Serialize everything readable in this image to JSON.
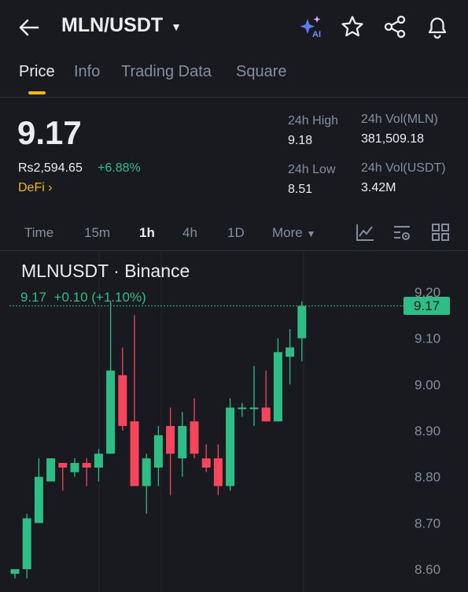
{
  "header": {
    "pair": "MLN/USDT",
    "icons": [
      "back-arrow-icon",
      "ai-sparkle-icon",
      "star-icon",
      "share-icon",
      "bell-icon"
    ]
  },
  "tabs": [
    {
      "label": "Price",
      "active": true
    },
    {
      "label": "Info",
      "active": false
    },
    {
      "label": "Trading Data",
      "active": false
    },
    {
      "label": "Square",
      "active": false
    }
  ],
  "ticker": {
    "price": "9.17",
    "fiat_price": "Rs2,594.65",
    "change_pct": "+6.88%",
    "tag": "DeFi",
    "high_label": "24h High",
    "high_value": "9.18",
    "low_label": "24h Low",
    "low_value": "8.51",
    "vol_base_label": "24h Vol(MLN)",
    "vol_base_value": "381,509.18",
    "vol_quote_label": "24h Vol(USDT)",
    "vol_quote_value": "3.42M"
  },
  "timeframes": {
    "items": [
      "Time",
      "15m",
      "1h",
      "4h",
      "1D"
    ],
    "active": "1h",
    "more_label": "More",
    "tools": [
      "indicator-icon",
      "chart-settings-icon",
      "layout-grid-icon"
    ]
  },
  "chart": {
    "title": "MLNUSDT · Binance",
    "ohlc_summary": "9.17  +0.10 (+1.10%)",
    "last_price_label": "9.17",
    "up_color": "#2ebd85",
    "down_color": "#f6465d"
  },
  "chart_data": {
    "type": "candlestick",
    "title": "MLNUSDT · Binance",
    "y_ticks": [
      "9.20",
      "9.10",
      "9.00",
      "8.90",
      "8.80",
      "8.70",
      "8.60"
    ],
    "ylim": [
      8.55,
      9.25
    ],
    "last_price": 9.17,
    "candles": [
      {
        "o": 8.59,
        "h": 8.6,
        "l": 8.58,
        "c": 8.6
      },
      {
        "o": 8.6,
        "h": 8.72,
        "l": 8.58,
        "c": 8.71
      },
      {
        "o": 8.7,
        "h": 8.84,
        "l": 8.7,
        "c": 8.8
      },
      {
        "o": 8.79,
        "h": 8.84,
        "l": 8.79,
        "c": 8.84
      },
      {
        "o": 8.83,
        "h": 8.83,
        "l": 8.77,
        "c": 8.82
      },
      {
        "o": 8.81,
        "h": 8.84,
        "l": 8.8,
        "c": 8.83
      },
      {
        "o": 8.83,
        "h": 8.84,
        "l": 8.78,
        "c": 8.82
      },
      {
        "o": 8.82,
        "h": 8.86,
        "l": 8.79,
        "c": 8.85
      },
      {
        "o": 8.85,
        "h": 9.18,
        "l": 8.85,
        "c": 9.03
      },
      {
        "o": 9.02,
        "h": 9.08,
        "l": 8.9,
        "c": 8.91
      },
      {
        "o": 8.92,
        "h": 9.15,
        "l": 8.78,
        "c": 8.78
      },
      {
        "o": 8.78,
        "h": 8.85,
        "l": 8.72,
        "c": 8.84
      },
      {
        "o": 8.82,
        "h": 8.91,
        "l": 8.78,
        "c": 8.89
      },
      {
        "o": 8.91,
        "h": 8.95,
        "l": 8.76,
        "c": 8.85
      },
      {
        "o": 8.84,
        "h": 8.94,
        "l": 8.8,
        "c": 8.91
      },
      {
        "o": 8.92,
        "h": 8.97,
        "l": 8.84,
        "c": 8.85
      },
      {
        "o": 8.84,
        "h": 8.87,
        "l": 8.81,
        "c": 8.82
      },
      {
        "o": 8.84,
        "h": 8.87,
        "l": 8.76,
        "c": 8.78
      },
      {
        "o": 8.78,
        "h": 8.97,
        "l": 8.77,
        "c": 8.95
      },
      {
        "o": 8.95,
        "h": 8.96,
        "l": 8.93,
        "c": 8.95
      },
      {
        "o": 8.95,
        "h": 9.04,
        "l": 8.91,
        "c": 8.95
      },
      {
        "o": 8.95,
        "h": 9.03,
        "l": 8.92,
        "c": 8.92
      },
      {
        "o": 8.92,
        "h": 9.1,
        "l": 8.92,
        "c": 9.07
      },
      {
        "o": 9.06,
        "h": 9.12,
        "l": 9.0,
        "c": 9.08
      },
      {
        "o": 9.1,
        "h": 9.18,
        "l": 9.05,
        "c": 9.17
      }
    ]
  }
}
